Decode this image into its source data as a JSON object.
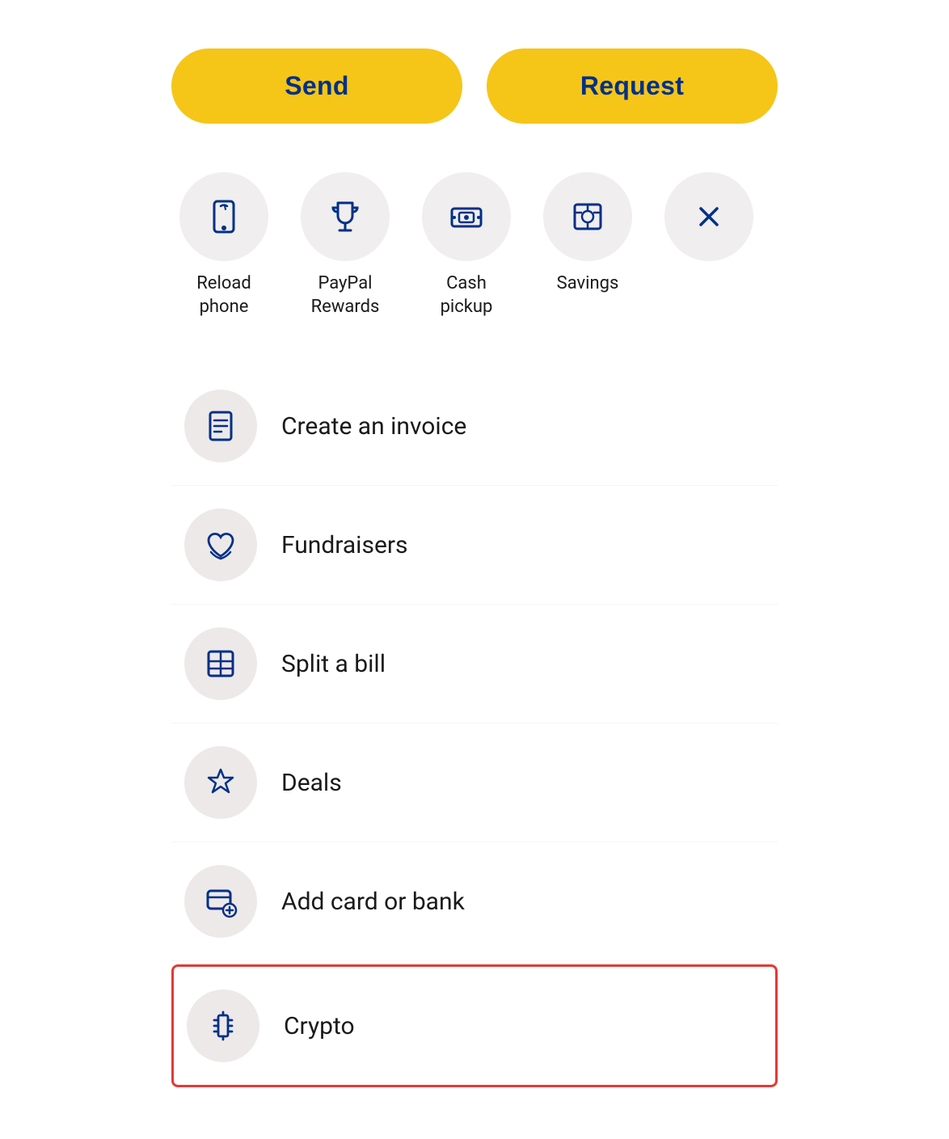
{
  "buttons": {
    "send_label": "Send",
    "request_label": "Request"
  },
  "quick_actions": [
    {
      "id": "reload-phone",
      "label": "Reload\nphone",
      "label_line1": "Reload",
      "label_line2": "phone",
      "icon": "reload-phone-icon"
    },
    {
      "id": "paypal-rewards",
      "label": "PayPal\nRewards",
      "label_line1": "PayPal",
      "label_line2": "Rewards",
      "icon": "trophy-icon"
    },
    {
      "id": "cash-pickup",
      "label": "Cash\npickup",
      "label_line1": "Cash",
      "label_line2": "pickup",
      "icon": "cash-pickup-icon"
    },
    {
      "id": "savings",
      "label": "Savings",
      "label_line1": "Savings",
      "label_line2": "",
      "icon": "savings-icon"
    },
    {
      "id": "close",
      "label": "",
      "icon": "close-icon"
    }
  ],
  "list_items": [
    {
      "id": "create-invoice",
      "label": "Create an invoice",
      "icon": "invoice-icon",
      "highlighted": false
    },
    {
      "id": "fundraisers",
      "label": "Fundraisers",
      "icon": "fundraisers-icon",
      "highlighted": false
    },
    {
      "id": "split-bill",
      "label": "Split a bill",
      "icon": "split-bill-icon",
      "highlighted": false
    },
    {
      "id": "deals",
      "label": "Deals",
      "icon": "deals-icon",
      "highlighted": false
    },
    {
      "id": "add-card-bank",
      "label": "Add card or bank",
      "icon": "add-card-icon",
      "highlighted": false
    },
    {
      "id": "crypto",
      "label": "Crypto",
      "icon": "crypto-icon",
      "highlighted": true
    }
  ],
  "colors": {
    "primary_blue": "#003087",
    "button_yellow": "#F5C518",
    "icon_circle_bg": "#ede9e9",
    "highlight_red": "#e53935"
  }
}
